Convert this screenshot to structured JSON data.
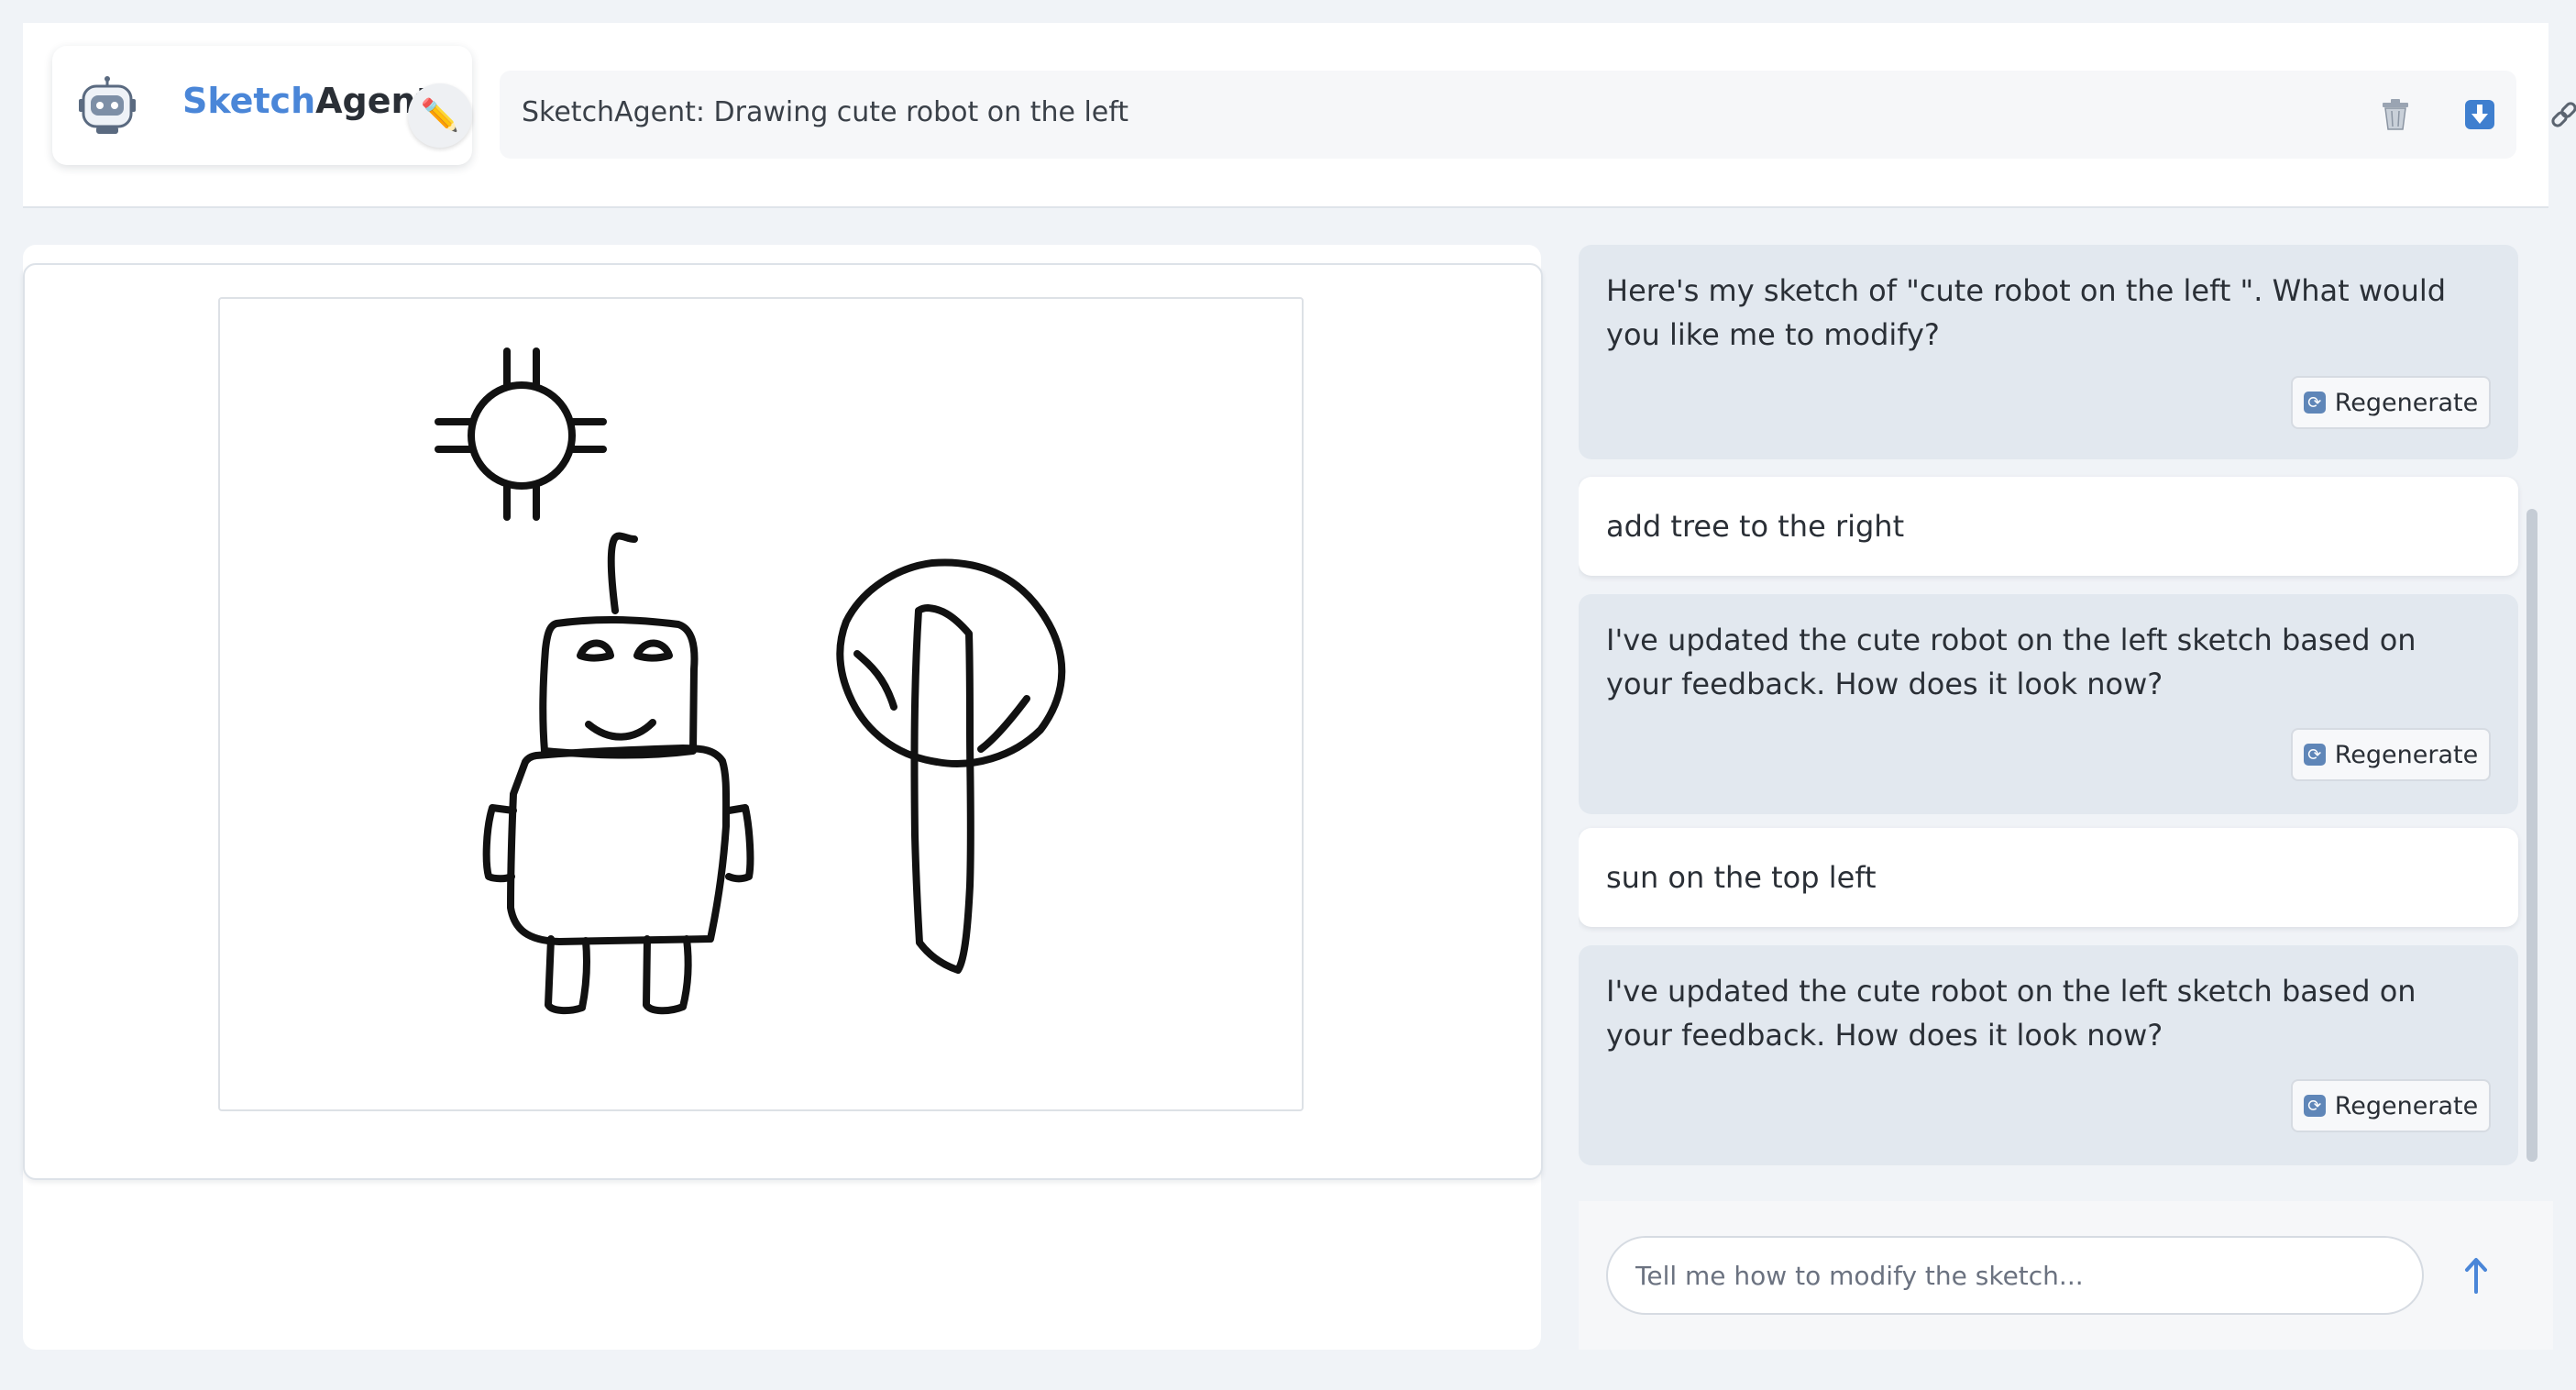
{
  "app": {
    "name_part1": "Sketch",
    "name_part2": "Agent",
    "edit_icon": "pencil-icon"
  },
  "title_bar": {
    "title": "SketchAgent: Drawing cute robot on the left",
    "actions": [
      {
        "name": "trash-icon",
        "glyph": "🗑"
      },
      {
        "name": "download-icon",
        "glyph": "⬇"
      },
      {
        "name": "link-icon",
        "glyph": "🔗"
      }
    ]
  },
  "chat": {
    "messages": [
      {
        "role": "assistant",
        "text": "Here's my sketch of \"cute robot on the left \". What would you like me to modify?",
        "button": "Regenerate"
      },
      {
        "role": "user",
        "text": "add tree to the right"
      },
      {
        "role": "assistant",
        "text": "I've updated the cute robot on the left sketch based on your feedback. How does it look now?",
        "button": "Regenerate"
      },
      {
        "role": "user",
        "text": "sun on the top left"
      },
      {
        "role": "assistant",
        "text": "I've updated the cute robot on the left sketch based on your feedback. How does it look now?",
        "button": "Regenerate"
      }
    ]
  },
  "composer": {
    "placeholder": "Tell me how to modify the sketch...",
    "send_icon": "arrow-up-icon"
  },
  "colors": {
    "accent": "#4a86d8",
    "assistant_bubble": "#e2e8ef",
    "user_bubble": "#ffffff"
  }
}
